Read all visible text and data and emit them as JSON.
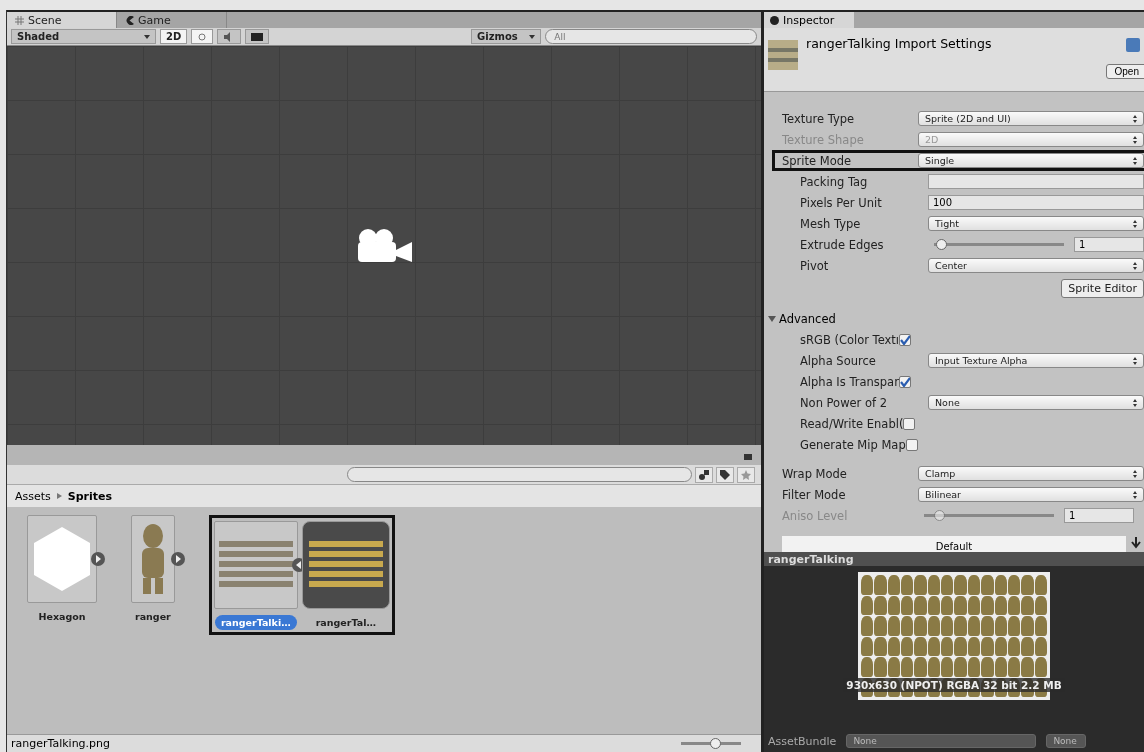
{
  "scene": {
    "tabs": [
      {
        "label": "Scene",
        "selected": true
      },
      {
        "label": "Game",
        "selected": false
      }
    ],
    "toolbar": {
      "shading": "Shaded",
      "mode_2d": "2D",
      "mode_2d_on": true,
      "lighting_on": true,
      "audio_on": false,
      "gizmos": "Gizmos",
      "search_placeholder": "All"
    }
  },
  "project": {
    "breadcrumb": [
      "Assets",
      "Sprites"
    ],
    "assets": [
      {
        "name": "Hexagon",
        "kind": "hexagon",
        "selected": false
      },
      {
        "name": "ranger",
        "kind": "character",
        "selected": false
      },
      {
        "name": "rangerTalki…",
        "kind": "sheet",
        "selected": true,
        "highlighted": true
      },
      {
        "name": "rangerTal…",
        "kind": "sheet-expanded",
        "selected": false,
        "highlighted": true
      }
    ],
    "status_file": "rangerTalking.png",
    "zoom": {
      "level": 0.6
    }
  },
  "inspector": {
    "tab": "Inspector",
    "title": "rangerTalking Import Settings",
    "open_button": "Open",
    "fields": [
      {
        "kind": "dropdown",
        "label": "Texture Type",
        "value": "Sprite (2D and UI)",
        "disabled": false
      },
      {
        "kind": "dropdown",
        "label": "Texture Shape",
        "value": "2D",
        "disabled": true
      },
      {
        "kind": "dropdown",
        "label": "Sprite Mode",
        "value": "Single",
        "disabled": false,
        "highlighted": true,
        "children": [
          {
            "kind": "text",
            "label": "Packing Tag",
            "disabled": false
          },
          {
            "kind": "text",
            "label": "Pixels Per Unit",
            "value": "100",
            "disabled": false
          },
          {
            "kind": "dropdown",
            "label": "Mesh Type",
            "value": "Tight",
            "disabled": false
          },
          {
            "kind": "slider",
            "label": "Extrude Edges",
            "value": "1",
            "level": 0.02,
            "disabled": false
          },
          {
            "kind": "dropdown",
            "label": "Pivot",
            "value": "Center",
            "disabled": false
          },
          {
            "kind": "button",
            "label": "Sprite Editor",
            "disabled": false
          }
        ]
      },
      {
        "kind": "foldout",
        "label": "Advanced",
        "expanded": true,
        "disabled": false,
        "children": [
          {
            "kind": "checkbox",
            "label": "sRGB (Color Textı",
            "checked": true,
            "disabled": false
          },
          {
            "kind": "dropdown",
            "label": "Alpha Source",
            "value": "Input Texture Alpha",
            "disabled": false
          },
          {
            "kind": "checkbox",
            "label": "Alpha Is Transpar",
            "checked": true,
            "disabled": false
          },
          {
            "kind": "dropdown",
            "label": "Non Power of 2",
            "value": "None",
            "disabled": false
          },
          {
            "kind": "checkbox",
            "label": "Read/Write Enabl(",
            "checked": false,
            "disabled": false
          },
          {
            "kind": "checkbox",
            "label": "Generate Mip Map",
            "checked": false,
            "disabled": false
          }
        ]
      },
      {
        "kind": "dropdown",
        "label": "Wrap Mode",
        "value": "Clamp",
        "disabled": false
      },
      {
        "kind": "dropdown",
        "label": "Filter Mode",
        "value": "Bilinear",
        "disabled": false
      },
      {
        "kind": "slider",
        "label": "Aniso Level",
        "value": "1",
        "level": 0.08,
        "disabled": true
      }
    ],
    "platform_tab": "Default",
    "preview": {
      "title": "rangerTalking",
      "info": "930x630 (NPOT) RGBA 32 bit 2.2 MB"
    },
    "asset_bundle": {
      "label": "AssetBundle",
      "value": "None",
      "variant": "None"
    }
  }
}
